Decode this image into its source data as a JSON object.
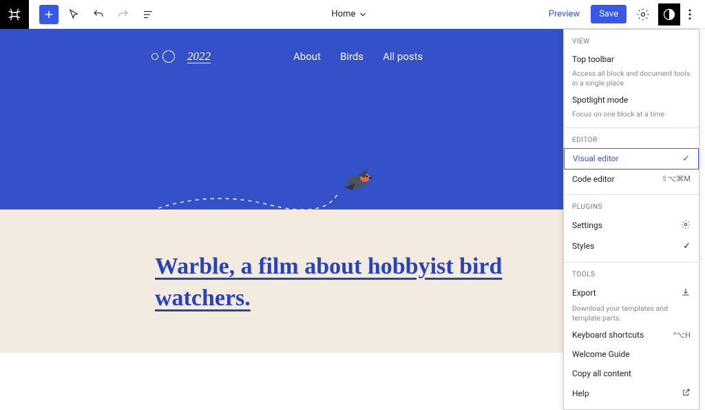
{
  "toolbar": {
    "doc_title": "Home",
    "preview_label": "Preview",
    "save_label": "Save"
  },
  "site": {
    "year": "2022",
    "nav": [
      "About",
      "Birds",
      "All posts"
    ],
    "headline": "Warble, a film about hobbyist bird watchers."
  },
  "menu": {
    "sections": {
      "view": {
        "label": "VIEW",
        "top_toolbar": {
          "title": "Top toolbar",
          "desc": "Access all block and document tools in a single place"
        },
        "spotlight": {
          "title": "Spotlight mode",
          "desc": "Focus on one block at a time"
        }
      },
      "editor": {
        "label": "EDITOR",
        "visual": {
          "title": "Visual editor"
        },
        "code": {
          "title": "Code editor",
          "shortcut": "⇧⌥⌘M"
        }
      },
      "plugins": {
        "label": "PLUGINS",
        "settings": "Settings",
        "styles": "Styles"
      },
      "tools": {
        "label": "TOOLS",
        "export": {
          "title": "Export",
          "desc": "Download your templates and template parts."
        },
        "shortcuts": {
          "title": "Keyboard shortcuts",
          "shortcut": "^⌥H"
        },
        "welcome": "Welcome Guide",
        "copy": "Copy all content",
        "help": "Help"
      }
    }
  }
}
